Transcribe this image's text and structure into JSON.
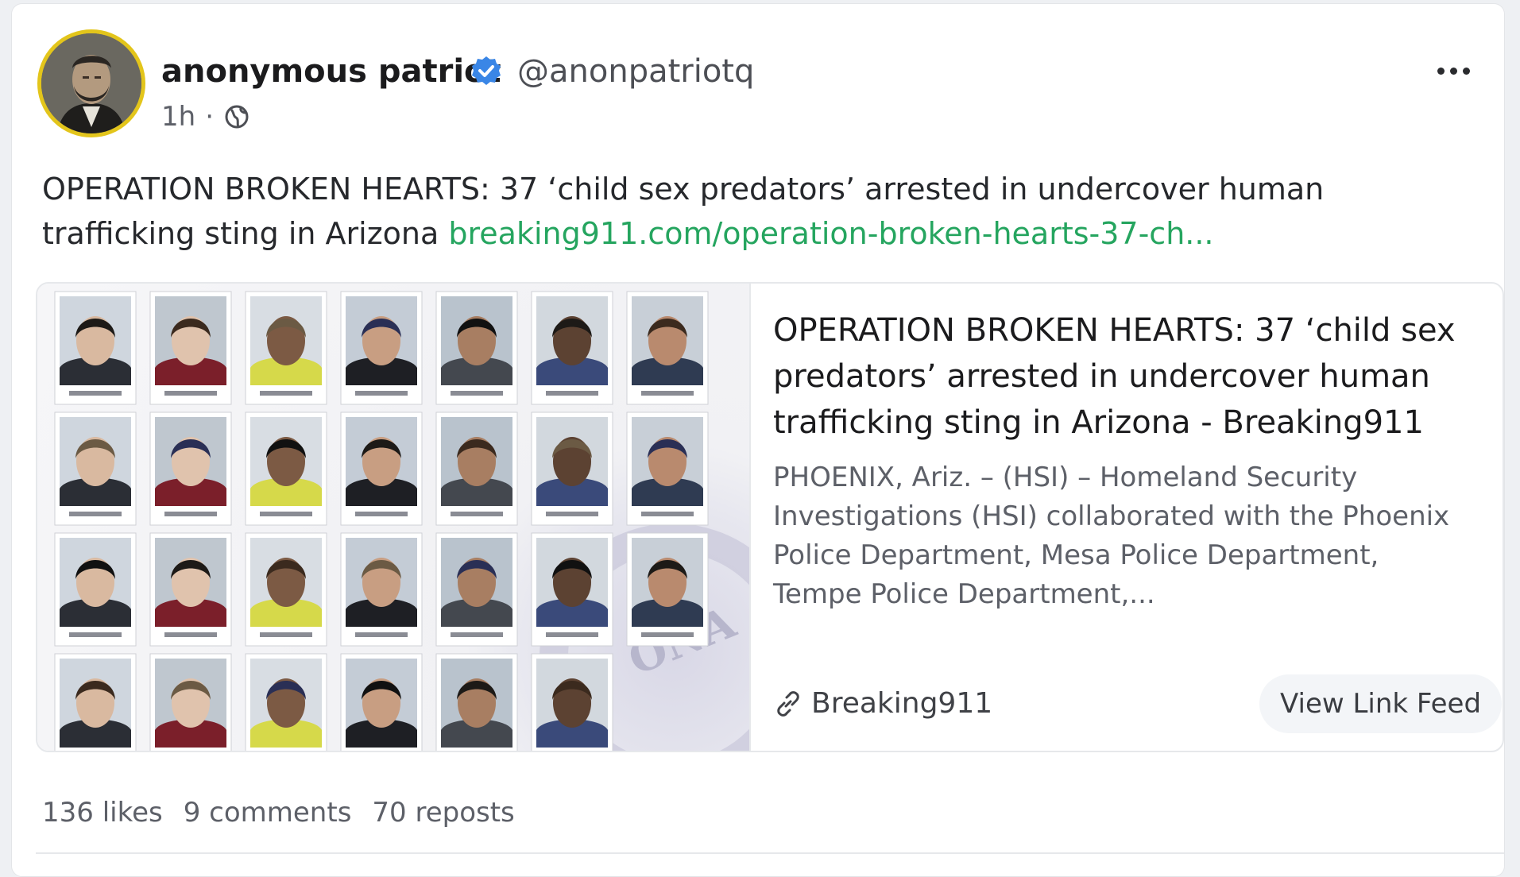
{
  "author": {
    "name": "anonymous patriot",
    "handle": "@anonpatriotq",
    "time": "1h",
    "separator": "·",
    "verified_color": "#3a86e6",
    "avatar_border_color": "#e3c51b"
  },
  "post": {
    "text": "OPERATION BROKEN HEARTS: 37 ‘child sex predators’ arrested in undercover human trafficking sting in Arizona",
    "link_text": "breaking911.com/operation-broken-hearts-37-ch...",
    "link_color": "#25a55f"
  },
  "card": {
    "title": "OPERATION BROKEN HEARTS: 37 ‘child sex predators’ arrested in undercover human trafficking sting in Arizona - Breaking911",
    "description": "PHOENIX, Ariz. – (HSI) – Homeland Security Investigations (HSI) collaborated with the Phoenix Police Department, Mesa Police Department, Tempe Police Department,...",
    "source": "Breaking911",
    "view_button": "View Link Feed",
    "image_watermark": "ONA"
  },
  "stats": {
    "likes": "136 likes",
    "comments": "9 comments",
    "reposts": "70 reposts"
  },
  "icons": {
    "more": "more-options-icon",
    "verified": "verified-badge-icon",
    "globe": "globe-icon",
    "link": "link-icon"
  }
}
